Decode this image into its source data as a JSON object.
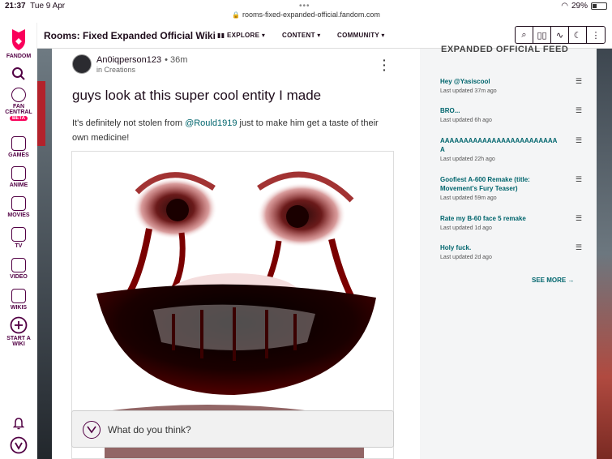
{
  "status_bar": {
    "time": "21:37",
    "date": "Tue 9 Apr",
    "battery": "29%",
    "url": "rooms-fixed-expanded-official.fandom.com"
  },
  "global_nav": {
    "brand": "FANDOM",
    "items": [
      {
        "label": "FAN CENTRAL",
        "badge": "BETA"
      },
      {
        "label": "GAMES"
      },
      {
        "label": "ANIME"
      },
      {
        "label": "MOVIES"
      },
      {
        "label": "TV"
      },
      {
        "label": "VIDEO"
      },
      {
        "label": "WIKIS"
      },
      {
        "label": "START A WIKI"
      }
    ]
  },
  "header": {
    "wiki_title": "Rooms: Fixed Expanded Official Wiki",
    "nav": [
      {
        "label": "EXPLORE"
      },
      {
        "label": "CONTENT"
      },
      {
        "label": "COMMUNITY"
      }
    ]
  },
  "post": {
    "author": "An0iqperson123",
    "time": "36m",
    "category": "in Creations",
    "title": "guys look at this super cool entity I made",
    "body_pre": "It's definitely not stolen from ",
    "mention": "@Rould1919",
    "body_post": " just to make him get a taste of their own medicine!",
    "reply_placeholder": "What do you think?"
  },
  "feed": {
    "title": "EXPANDED OFFICIAL FEED",
    "items": [
      {
        "title": "Hey @Yasiscool",
        "updated": "Last updated 37m ago"
      },
      {
        "title": "BRO...",
        "updated": "Last updated 6h ago"
      },
      {
        "title": "AAAAAAAAAAAAAAAAAAAAAAAAAA",
        "updated": "Last updated 22h ago"
      },
      {
        "title": "Goofiest A-600 Remake (title: Movement's Fury Teaser)",
        "updated": "Last updated 59m ago"
      },
      {
        "title": "Rate my B-60 face 5 remake",
        "updated": "Last updated 1d ago"
      },
      {
        "title": "Holy fuck.",
        "updated": "Last updated 2d ago"
      }
    ],
    "see_more": "SEE MORE"
  },
  "colors": {
    "brand": "#fa005a",
    "link": "#00656d",
    "nav_text": "#520044"
  }
}
